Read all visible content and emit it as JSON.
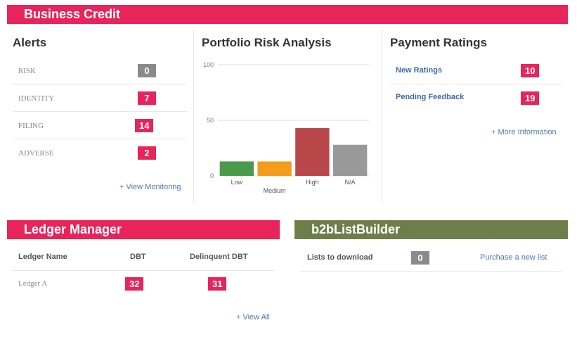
{
  "business_credit": {
    "title": "Business Credit"
  },
  "alerts": {
    "title": "Alerts",
    "items": [
      {
        "label": "RISK",
        "count": "0",
        "color": "#8a8a8a"
      },
      {
        "label": "IDENTITY",
        "count": "7",
        "color": "#e8245a"
      },
      {
        "label": "FILING",
        "count": "14",
        "color": "#e8245a"
      },
      {
        "label": "ADVERSE",
        "count": "2",
        "color": "#e8245a"
      }
    ],
    "view_link": "+ View Monitoring"
  },
  "portfolio": {
    "title": "Portfolio Risk Analysis",
    "chart_data": {
      "type": "bar",
      "categories": [
        "Low",
        "Medium",
        "High",
        "N/A"
      ],
      "values": [
        13,
        13,
        43,
        28
      ],
      "colors": [
        "#4a9a4a",
        "#f39c1e",
        "#b9474a",
        "#999999"
      ],
      "ylim": [
        0,
        100
      ],
      "yticks": [
        "0",
        "50",
        "100"
      ]
    }
  },
  "payment": {
    "title": "Payment Ratings",
    "items": [
      {
        "label": "New Ratings",
        "count": "10"
      },
      {
        "label": "Pending Feedback",
        "count": "19"
      }
    ],
    "more_link": "+ More Information"
  },
  "ledger": {
    "title": "Ledger Manager",
    "columns": [
      "Ledger Name",
      "DBT",
      "Delinquent DBT"
    ],
    "rows": [
      {
        "name": "Ledger A",
        "dbt": "32",
        "delinquent": "31"
      }
    ],
    "view_all": "+ View All"
  },
  "b2b": {
    "title": "b2bListBuilder",
    "lists_label": "Lists to download",
    "lists_count": "0",
    "purchase_link": "Purchase a new list"
  }
}
